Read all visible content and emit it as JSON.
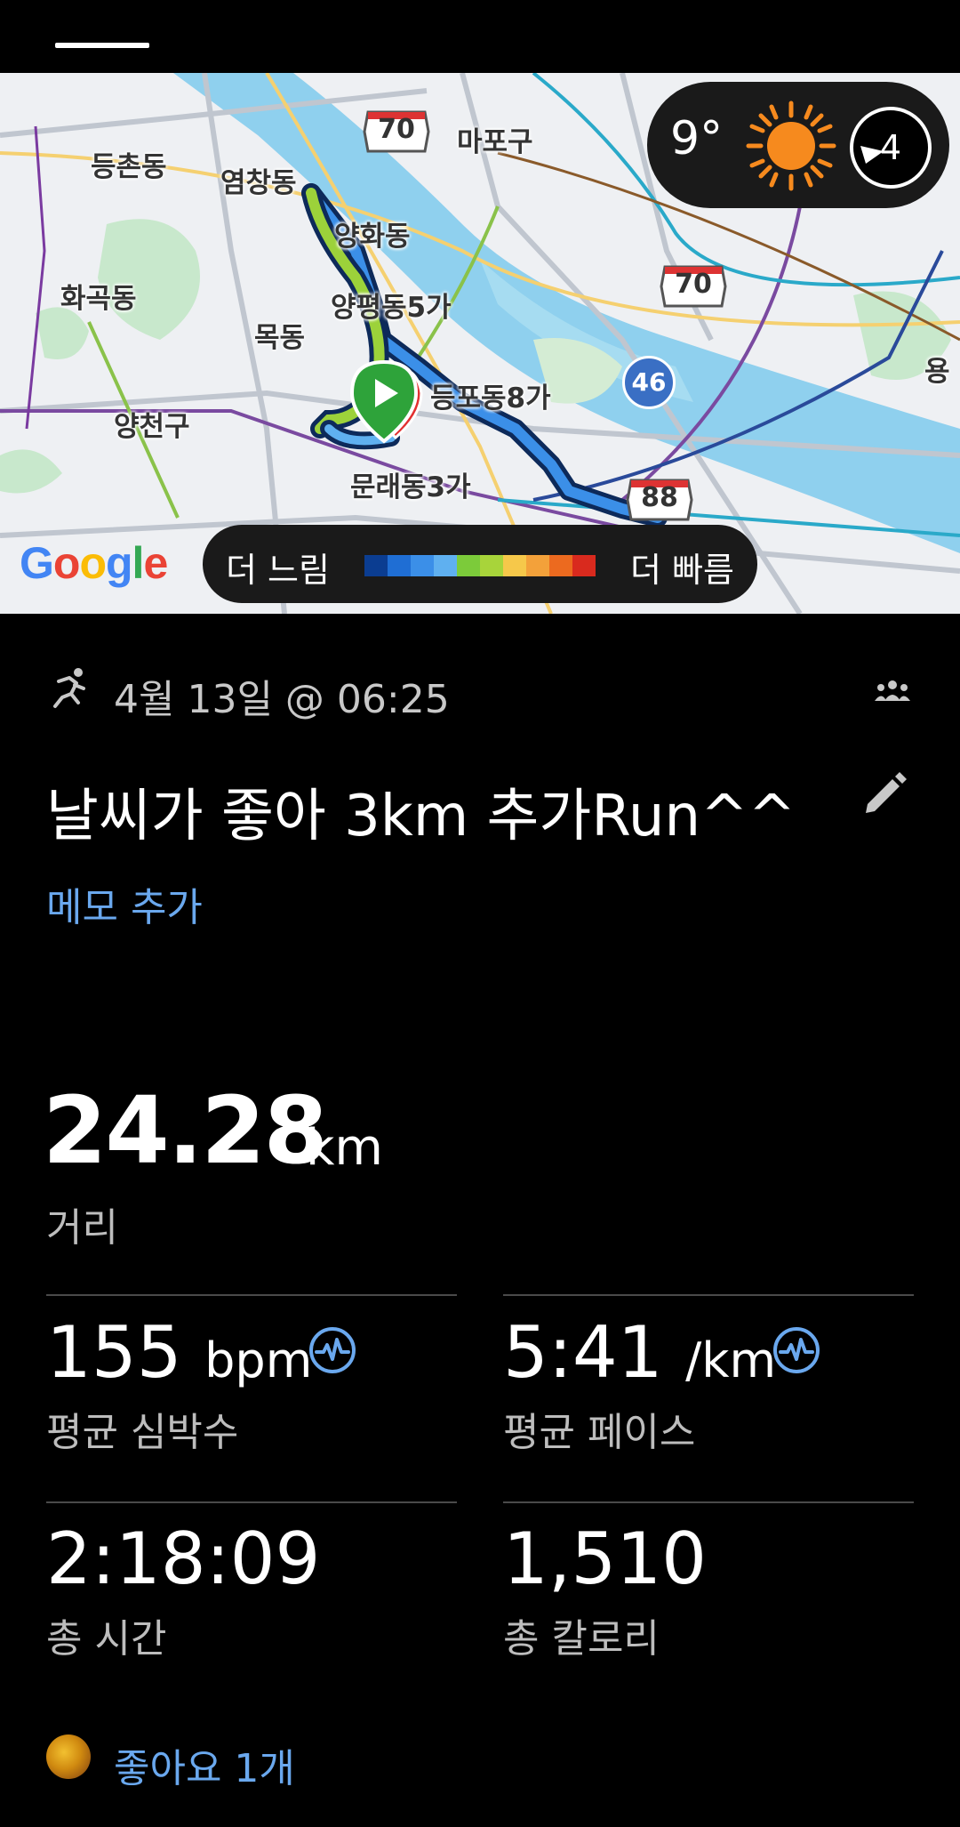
{
  "map": {
    "labels": {
      "mapo": "마포구",
      "deungchon": "등촌동",
      "yeomchang": "염창동",
      "yanghwa": "양화동",
      "hwagok": "화곡동",
      "yangpyeong": "양평동5가",
      "mok": "목동",
      "yeongdeungpo": "등포동8가",
      "yangcheon": "양천구",
      "mullae": "문래동3가",
      "yong": "용"
    },
    "routes": {
      "r70a": "70",
      "r70b": "70",
      "r46": "46",
      "r88": "88"
    },
    "weather": {
      "temp": "9°",
      "uv": "4"
    },
    "google_logo": "Google",
    "speed_legend": {
      "slow": "더 느림",
      "fast": "더 빠름",
      "colors": [
        "#0b3d91",
        "#1f6ed4",
        "#3b8fe8",
        "#5fb0f0",
        "#7ccb3a",
        "#a8d43a",
        "#f6c84a",
        "#f3a13a",
        "#ec6a1f",
        "#d92a1e"
      ]
    }
  },
  "activity": {
    "date": "4월 13일 @ 06:25",
    "title": "날씨가 좋아 3km 추가Run^^",
    "memo_link": "메모 추가",
    "distance": {
      "value": "24.28",
      "unit": "km",
      "label": "거리"
    },
    "stats": {
      "heart_rate": {
        "value": "155",
        "unit": "bpm",
        "label": "평균 심박수"
      },
      "pace": {
        "value": "5:41",
        "unit": "/km",
        "label": "평균 페이스"
      },
      "total_time": {
        "value": "2:18:09",
        "label": "총 시간"
      },
      "calories": {
        "value": "1,510",
        "label": "총 칼로리"
      }
    },
    "likes": "좋아요 1개"
  },
  "colors": {
    "accent": "#6aa8ee",
    "background": "#000000"
  }
}
